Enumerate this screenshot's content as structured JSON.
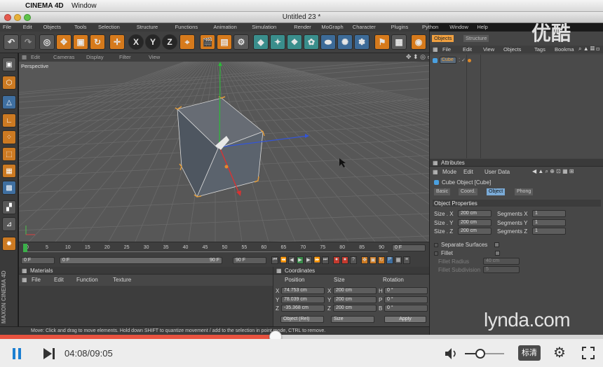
{
  "mac": {
    "app": "CINEMA 4D",
    "window_menu": "Window"
  },
  "window": {
    "title": "Untitled 23 *"
  },
  "watermark": {
    "youku": "优酷",
    "lynda": "lynda.com",
    "maxon": "MAXON CINEMA 4D"
  },
  "menubar": [
    "File",
    "Edit",
    "Objects",
    "Tools",
    "Selection",
    "Structure",
    "Functions",
    "Animation",
    "Simulation",
    "Render",
    "MoGraph",
    "Character",
    "Plugins",
    "Python",
    "Window",
    "Help"
  ],
  "axis_buttons": [
    "X",
    "Y",
    "Z"
  ],
  "viewport": {
    "menu": [
      "Edit",
      "Cameras",
      "Display",
      "Filter",
      "View"
    ],
    "label": "Perspective"
  },
  "timeline": {
    "ticks": [
      "0",
      "5",
      "10",
      "15",
      "20",
      "25",
      "30",
      "35",
      "40",
      "45",
      "50",
      "55",
      "60",
      "65",
      "70",
      "75",
      "80",
      "85",
      "90"
    ],
    "frame_display": "0 F",
    "start": "0 F",
    "current": "0 F",
    "range_end": "90 F",
    "end": "90 F"
  },
  "materials": {
    "title": "Materials",
    "menu": [
      "File",
      "Edit",
      "Function",
      "Texture"
    ]
  },
  "coordinates": {
    "title": "Coordinates",
    "headers": [
      "Position",
      "Size",
      "Rotation"
    ],
    "rows": [
      {
        "axis": "X",
        "pos": "74.753 cm",
        "size_axis": "X",
        "size": "200 cm",
        "rot_axis": "H",
        "rot": "0 °"
      },
      {
        "axis": "Y",
        "pos": "78.039 cm",
        "size_axis": "Y",
        "size": "200 cm",
        "rot_axis": "P",
        "rot": "0 °"
      },
      {
        "axis": "Z",
        "pos": "-35.368 cm",
        "size_axis": "Z",
        "size": "200 cm",
        "rot_axis": "B",
        "rot": "0 °"
      }
    ],
    "mode_select": "Object (Rel)",
    "size_select": "Size",
    "apply": "Apply"
  },
  "status": "Move: Click and drag to move elements. Hold down SHIFT to quantize movement / add to the selection in point mode, CTRL to remove.",
  "objects_panel": {
    "tabs": [
      "Objects",
      "Structure"
    ],
    "menu": [
      "File",
      "Edit",
      "View",
      "Objects",
      "Tags",
      "Bookma"
    ],
    "items": [
      {
        "name": "Cube"
      }
    ]
  },
  "attributes": {
    "title": "Attributes",
    "menu": [
      "Mode",
      "Edit",
      "User Data"
    ],
    "object_label": "Cube Object [Cube]",
    "tabs": [
      "Basic",
      "Coord.",
      "Object",
      "Phong"
    ],
    "active_tab": 2,
    "section": "Object Properties",
    "props": [
      {
        "label": "Size . X",
        "value": "200 cm",
        "seg_label": "Segments X",
        "seg": "1"
      },
      {
        "label": "Size . Y",
        "value": "200 cm",
        "seg_label": "Segments Y",
        "seg": "1"
      },
      {
        "label": "Size . Z",
        "value": "200 cm",
        "seg_label": "Segments Z",
        "seg": "1"
      }
    ],
    "separate_surfaces": "Separate Surfaces",
    "fillet": "Fillet",
    "fillet_radius": "Fillet Radius",
    "fillet_radius_value": "40 cm",
    "fillet_subdivision": "Fillet Subdivision",
    "fillet_subdivision_value": "5"
  },
  "player": {
    "time": "04:08/09:05",
    "progress": 0.457,
    "volume": 0.4,
    "quality": "标清"
  },
  "colors": {
    "accent": "#e8523f",
    "c4d_orange": "#d67a1c",
    "c4d_blue": "#3d6b98"
  }
}
